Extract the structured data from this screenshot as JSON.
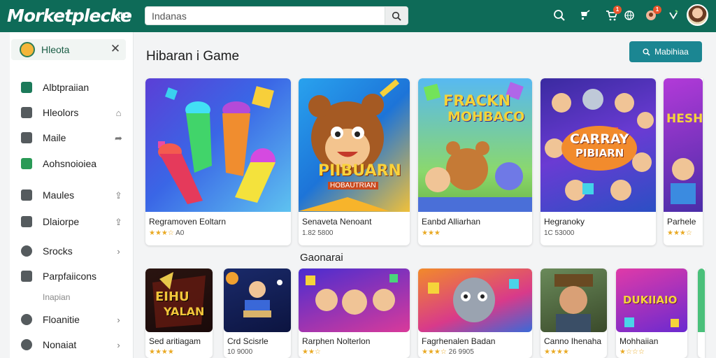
{
  "header": {
    "logo_text": "Morketplecke",
    "logo_suffix": "tm",
    "search_value": "Indanas",
    "icons": [
      "search-icon",
      "storefront-icon",
      "cart-icon",
      "globe-icon",
      "notification-icon",
      "gift-icon"
    ],
    "badges": {
      "cart": "1",
      "notification": "1"
    },
    "brand_color": "#0e6b58"
  },
  "sidebar": {
    "header_label": "Hleota",
    "items": [
      {
        "label": "Albtpraiian",
        "icon": "home-icon",
        "color": "#1c7a5a"
      },
      {
        "label": "Hleolors",
        "icon": "folder-icon",
        "color": "#555b5e"
      },
      {
        "label": "Maile",
        "icon": "document-icon",
        "color": "#555b5e"
      },
      {
        "label": "Aohsnoioiea",
        "icon": "checkbox-icon",
        "color": "#2a9a56"
      },
      {
        "label": "Maules",
        "icon": "file-icon",
        "color": "#555b5e"
      },
      {
        "label": "Dlaiorpe",
        "icon": "chart-icon",
        "color": "#555b5e"
      },
      {
        "label": "Srocks",
        "icon": "settings-icon",
        "color": "#555b5e"
      },
      {
        "label": "Parpfaiicons",
        "icon": "tag-icon",
        "color": "#555b5e"
      },
      {
        "label": "Floanitie",
        "icon": "clock-icon",
        "color": "#555b5e"
      },
      {
        "label": "Nonaiat",
        "icon": "info-icon",
        "color": "#555b5e"
      }
    ],
    "sub_label": "Inapian"
  },
  "main": {
    "title": "Hibaran i Game",
    "primary_button": "Mabihiaa",
    "section2_title": "Gaonarai",
    "row1": [
      {
        "name": "Regramoven Eoltarn",
        "meta": "A0",
        "stars": "★★★☆",
        "art": "popsicle"
      },
      {
        "name": "Senaveta Nenoant",
        "meta": "1.82 5800",
        "stars": "",
        "art": "bear"
      },
      {
        "name": "Eanbd Alliarhan",
        "meta": "",
        "stars": "★★★",
        "art": "friends"
      },
      {
        "name": "Hegranoky",
        "meta": "1C 53000",
        "stars": "",
        "art": "crowd"
      },
      {
        "name": "Parhele",
        "meta": "",
        "stars": "★★★☆",
        "art": "purple"
      }
    ],
    "row2": [
      {
        "name": "Sed aritiagam",
        "meta": "",
        "stars": "★★★★",
        "art": "dark"
      },
      {
        "name": "Crd Scisrle",
        "meta": "10 9000",
        "stars": "",
        "art": "space"
      },
      {
        "name": "Rarphen Nolterlon",
        "meta": "",
        "stars": "★★☆",
        "art": "kids"
      },
      {
        "name": "Fagrhenalen Badan",
        "meta": "26 9905",
        "stars": "★★★☆",
        "art": "wolf"
      },
      {
        "name": "Canno Ihenaha",
        "meta": "",
        "stars": "★★★★",
        "art": "soldier"
      },
      {
        "name": "Mohhaiian",
        "meta": "",
        "stars": "★☆☆☆",
        "art": "pink"
      }
    ],
    "art_badge_text": {
      "bear": "PIIBUARN",
      "bear_sub": "HOBAUTRIAN",
      "friends": "FRACKN",
      "friends_sub": "MOHBACO",
      "crowd": "CARRAY",
      "crowd_sub": "PIBIARN",
      "dark": "EIHU",
      "dark_sub": "YALAN",
      "pink": "DUKIIAIO",
      "purple": "HESH"
    }
  }
}
